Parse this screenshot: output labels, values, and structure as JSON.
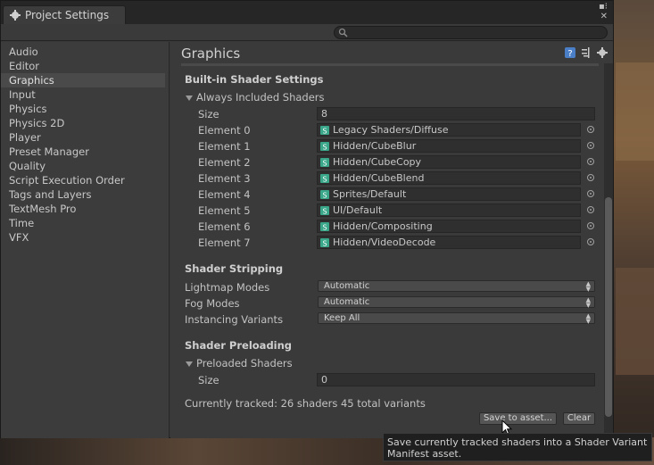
{
  "window": {
    "title": "Project Settings"
  },
  "sidebar": {
    "items": [
      {
        "label": "Audio"
      },
      {
        "label": "Editor"
      },
      {
        "label": "Graphics",
        "selected": true
      },
      {
        "label": "Input"
      },
      {
        "label": "Physics"
      },
      {
        "label": "Physics 2D"
      },
      {
        "label": "Player"
      },
      {
        "label": "Preset Manager"
      },
      {
        "label": "Quality"
      },
      {
        "label": "Script Execution Order"
      },
      {
        "label": "Tags and Layers"
      },
      {
        "label": "TextMesh Pro"
      },
      {
        "label": "Time"
      },
      {
        "label": "VFX"
      }
    ]
  },
  "panel": {
    "title": "Graphics",
    "builtin": {
      "heading": "Built-in Shader Settings",
      "foldout": "Always Included Shaders",
      "size_label": "Size",
      "size_value": "8",
      "elements": [
        {
          "label": "Element 0",
          "value": "Legacy Shaders/Diffuse"
        },
        {
          "label": "Element 1",
          "value": "Hidden/CubeBlur"
        },
        {
          "label": "Element 2",
          "value": "Hidden/CubeCopy"
        },
        {
          "label": "Element 3",
          "value": "Hidden/CubeBlend"
        },
        {
          "label": "Element 4",
          "value": "Sprites/Default"
        },
        {
          "label": "Element 5",
          "value": "UI/Default"
        },
        {
          "label": "Element 6",
          "value": "Hidden/Compositing"
        },
        {
          "label": "Element 7",
          "value": "Hidden/VideoDecode"
        }
      ]
    },
    "stripping": {
      "heading": "Shader Stripping",
      "rows": [
        {
          "label": "Lightmap Modes",
          "value": "Automatic"
        },
        {
          "label": "Fog Modes",
          "value": "Automatic"
        },
        {
          "label": "Instancing Variants",
          "value": "Keep All"
        }
      ]
    },
    "preloading": {
      "heading": "Shader Preloading",
      "foldout": "Preloaded Shaders",
      "size_label": "Size",
      "size_value": "0",
      "tracked": "Currently tracked: 26 shaders 45 total variants",
      "save_button": "Save to asset...",
      "clear_button": "Clear"
    }
  },
  "tooltip": {
    "text": "Save currently tracked shaders into a Shader Variant Manifest asset."
  },
  "colors": {
    "window_bg": "#383838",
    "field_bg": "#2f2f2f",
    "selected_bg": "#4a4a4a",
    "shader_icon": "#3aa68a"
  }
}
